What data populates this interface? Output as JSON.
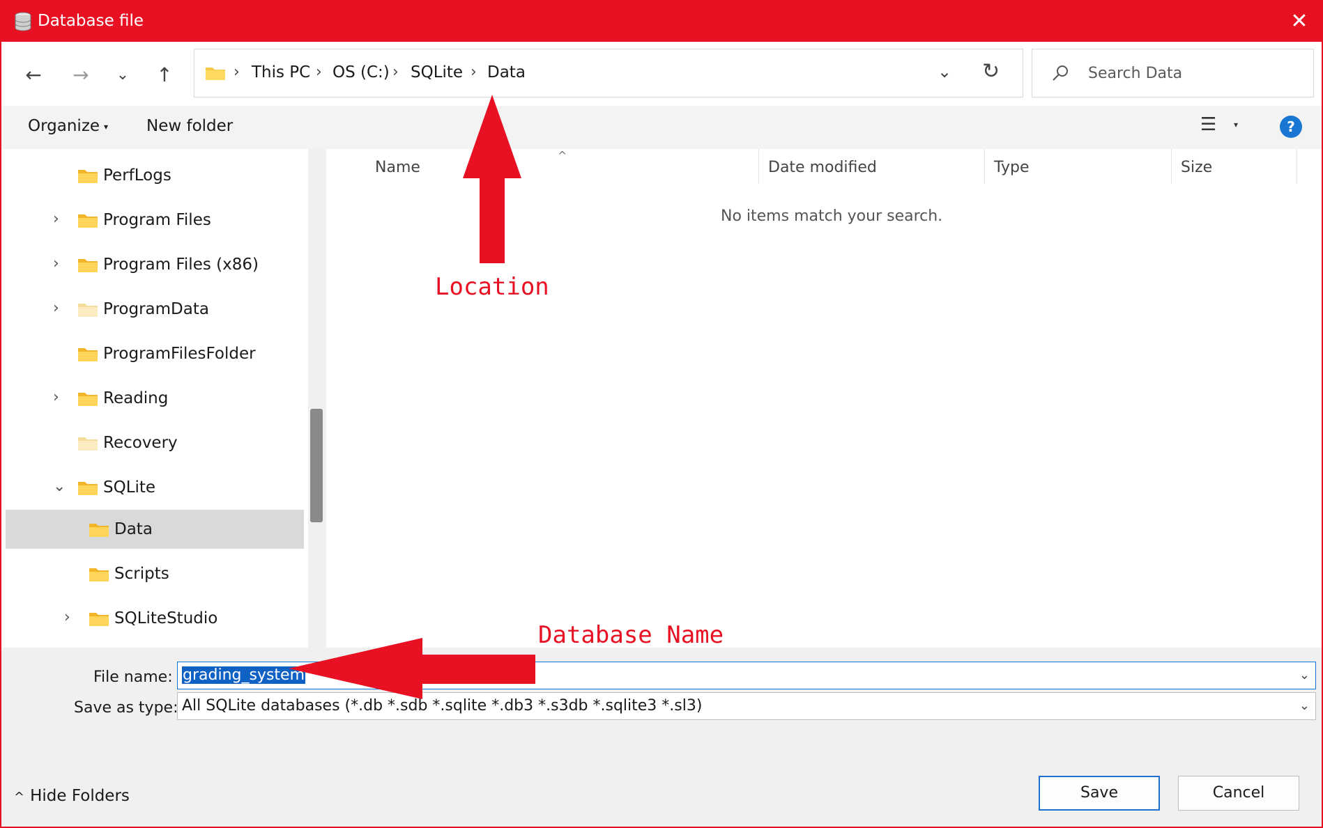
{
  "window": {
    "title": "Database file",
    "close_glyph": "✕"
  },
  "nav": {
    "back_glyph": "←",
    "forward_glyph": "→",
    "recent_glyph": "⌄",
    "up_glyph": "↑",
    "breadcrumbs": [
      "This PC",
      "OS (C:)",
      "SQLite",
      "Data"
    ],
    "breadcrumb_sep": "›",
    "dropdown_glyph": "⌄",
    "refresh_glyph": "↻",
    "search_placeholder": "Search Data"
  },
  "commands": {
    "organize": "Organize",
    "organize_caret": "▾",
    "new_folder": "New folder",
    "view_glyph": "☰",
    "view_caret": "▾",
    "help_glyph": "?"
  },
  "tree": [
    {
      "label": "PerfLogs",
      "chevron": "",
      "folder": "folder-icon"
    },
    {
      "label": "Program Files",
      "chevron": "›",
      "folder": "folder-icon"
    },
    {
      "label": "Program Files (x86)",
      "chevron": "›",
      "folder": "folder-icon"
    },
    {
      "label": "ProgramData",
      "chevron": "›",
      "folder": "folder-icon"
    },
    {
      "label": "ProgramFilesFolder",
      "chevron": "",
      "folder": "folder-icon"
    },
    {
      "label": "Reading",
      "chevron": "›",
      "folder": "folder-icon"
    },
    {
      "label": "Recovery",
      "chevron": "",
      "folder": "folder-icon"
    },
    {
      "label": "SQLite",
      "chevron": "⌄",
      "folder": "folder-icon"
    },
    {
      "label": "Data",
      "chevron": "",
      "folder": "folder-icon"
    },
    {
      "label": "Scripts",
      "chevron": "",
      "folder": "folder-icon"
    },
    {
      "label": "SQLiteStudio",
      "chevron": "›",
      "folder": "folder-icon"
    }
  ],
  "columns": {
    "name": "Name",
    "date": "Date modified",
    "type": "Type",
    "size": "Size",
    "sort_glyph": "^"
  },
  "empty_message": "No items match your search.",
  "form": {
    "file_name_label": "File name:",
    "file_name_value": "grading_system",
    "save_type_label": "Save as type:",
    "save_type_value": "All SQLite databases (*.db *.sdb *.sqlite *.db3 *.s3db *.sqlite3 *.sl3)",
    "combo_glyph": "⌄"
  },
  "footer": {
    "hide_folders": "Hide Folders",
    "hide_glyph": "^",
    "save": "Save",
    "cancel": "Cancel"
  },
  "annotations": {
    "location": "Location",
    "database_name": "Database Name",
    "color": "#e81123"
  },
  "colors": {
    "titlebar": "#e81123",
    "selection": "#0f62c4",
    "help": "#1976d2"
  }
}
